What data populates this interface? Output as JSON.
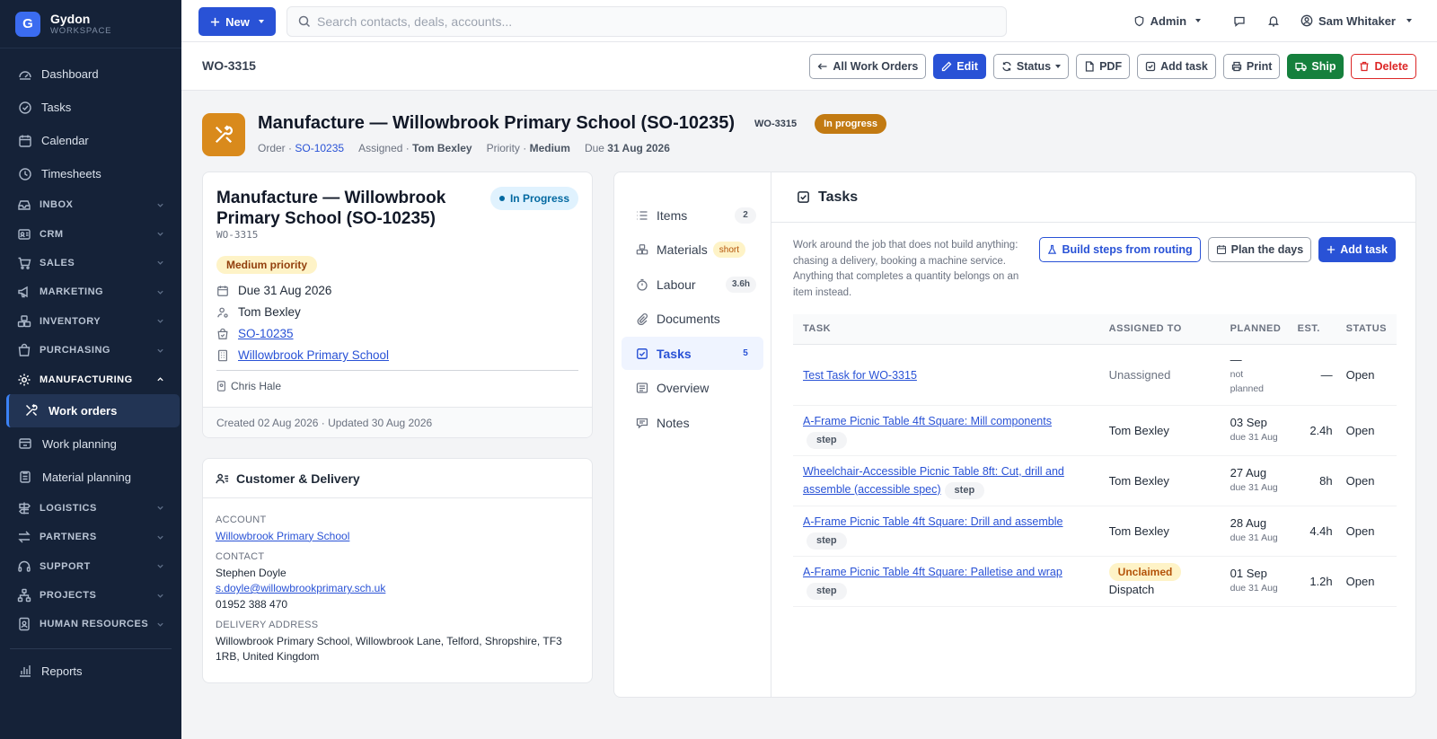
{
  "brand": {
    "name": "Gydon",
    "sub": "WORKSPACE",
    "logo_letter": "G"
  },
  "nav": {
    "top": [
      {
        "label": "Dashboard",
        "icon": "dashboard-icon"
      },
      {
        "label": "Tasks",
        "icon": "check-circle-icon"
      },
      {
        "label": "Calendar",
        "icon": "calendar-icon"
      },
      {
        "label": "Timesheets",
        "icon": "clock-icon"
      }
    ],
    "groups": [
      {
        "label": "INBOX"
      },
      {
        "label": "CRM"
      },
      {
        "label": "SALES"
      },
      {
        "label": "MARKETING"
      },
      {
        "label": "INVENTORY"
      },
      {
        "label": "PURCHASING"
      }
    ],
    "manufacturing": {
      "label": "MANUFACTURING",
      "items": [
        {
          "label": "Work orders"
        },
        {
          "label": "Work planning"
        },
        {
          "label": "Material planning"
        }
      ]
    },
    "groups2": [
      {
        "label": "LOGISTICS"
      },
      {
        "label": "PARTNERS"
      },
      {
        "label": "SUPPORT"
      },
      {
        "label": "PROJECTS"
      },
      {
        "label": "HUMAN RESOURCES"
      }
    ],
    "reports": "Reports"
  },
  "topbar": {
    "new_label": "New",
    "search_placeholder": "Search contacts, deals, accounts...",
    "admin_label": "Admin",
    "user_name": "Sam Whitaker"
  },
  "toolbar": {
    "code": "WO-3315",
    "all_label": "All Work Orders",
    "edit_label": "Edit",
    "status_label": "Status",
    "pdf_label": "PDF",
    "add_task_label": "Add task",
    "print_label": "Print",
    "ship_label": "Ship",
    "delete_label": "Delete"
  },
  "header": {
    "title": "Manufacture — Willowbrook Primary School (SO-10235)",
    "code": "WO-3315",
    "status": "In progress",
    "order_label": "Order ·",
    "order": "SO-10235",
    "assigned_label": "Assigned ·",
    "assigned": "Tom Bexley",
    "priority_label": "Priority ·",
    "priority": "Medium",
    "due_label": "Due",
    "due": "31 Aug 2026"
  },
  "summary": {
    "title": "Manufacture — Willowbrook Primary School (SO-10235)",
    "status": "In Progress",
    "code": "WO-3315",
    "priority": "Medium priority",
    "due": "Due 31 Aug 2026",
    "assignee": "Tom Bexley",
    "order": "SO-10235",
    "customer": "Willowbrook Primary School",
    "owner": "Chris Hale",
    "footer": "Created 02 Aug 2026 · Updated 30 Aug 2026"
  },
  "customer": {
    "title": "Customer & Delivery",
    "account_label": "ACCOUNT",
    "account": "Willowbrook Primary School",
    "contact_label": "CONTACT",
    "contact_name": "Stephen Doyle",
    "contact_email": "s.doyle@willowbrookprimary.sch.uk",
    "contact_phone": "01952 388 470",
    "address_label": "DELIVERY ADDRESS",
    "address": "Willowbrook Primary School, Willowbrook Lane, Telford, Shropshire, TF3 1RB, United Kingdom"
  },
  "tabs": [
    {
      "label": "Items",
      "count": "2"
    },
    {
      "label": "Materials",
      "count": "short"
    },
    {
      "label": "Labour",
      "count": "3.6h"
    },
    {
      "label": "Documents",
      "count": ""
    },
    {
      "label": "Tasks",
      "count": "5"
    },
    {
      "label": "Overview",
      "count": ""
    },
    {
      "label": "Notes",
      "count": ""
    }
  ],
  "tasks": {
    "title": "Tasks",
    "description": "Work around the job that does not build anything: chasing a delivery, booking a machine service. Anything that completes a quantity belongs on an item instead.",
    "build_label": "Build steps from routing",
    "plan_label": "Plan the days",
    "add_label": "Add task",
    "columns": [
      "TASK",
      "ASSIGNED TO",
      "PLANNED",
      "EST.",
      "STATUS"
    ],
    "rows": [
      {
        "task": "Test Task for WO-3315",
        "step": "",
        "assigned": "Unassigned",
        "planned": "—",
        "planned_sub": "not planned",
        "est": "—",
        "status": "Open"
      },
      {
        "task": "A-Frame Picnic Table 4ft Square: Mill components",
        "step": "step",
        "assigned": "Tom Bexley",
        "planned": "03 Sep",
        "planned_sub": "due 31 Aug",
        "est": "2.4h",
        "status": "Open"
      },
      {
        "task": "Wheelchair-Accessible Picnic Table 8ft: Cut, drill and assemble (accessible spec)",
        "step": "step",
        "assigned": "Tom Bexley",
        "planned": "27 Aug",
        "planned_sub": "due 31 Aug",
        "est": "8h",
        "status": "Open"
      },
      {
        "task": "A-Frame Picnic Table 4ft Square: Drill and assemble",
        "step": "step",
        "assigned": "Tom Bexley",
        "planned": "28 Aug",
        "planned_sub": "due 31 Aug",
        "est": "4.4h",
        "status": "Open"
      },
      {
        "task": "A-Frame Picnic Table 4ft Square: Palletise and wrap",
        "step": "step",
        "assigned_badge": "Unclaimed",
        "assigned": "Dispatch",
        "planned": "01 Sep",
        "planned_sub": "due 31 Aug",
        "est": "1.2h",
        "status": "Open"
      }
    ]
  }
}
